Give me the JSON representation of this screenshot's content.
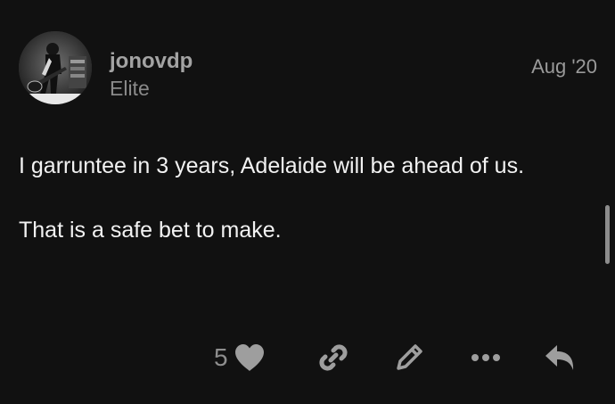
{
  "post": {
    "username": "jonovdp",
    "user_title": "Elite",
    "date": "Aug '20",
    "paragraphs": [
      "I garruntee in 3 years, Adelaide will be ahead of us.",
      "That is a safe bet to make."
    ],
    "like_count": "5"
  },
  "icons": {
    "like": "heart-icon",
    "share": "link-icon",
    "edit": "pencil-icon",
    "more": "ellipsis-icon",
    "reply": "reply-arrow-icon"
  },
  "colors": {
    "background": "#111111",
    "icon": "#9e9e9e",
    "text": "#f2f2f2"
  }
}
